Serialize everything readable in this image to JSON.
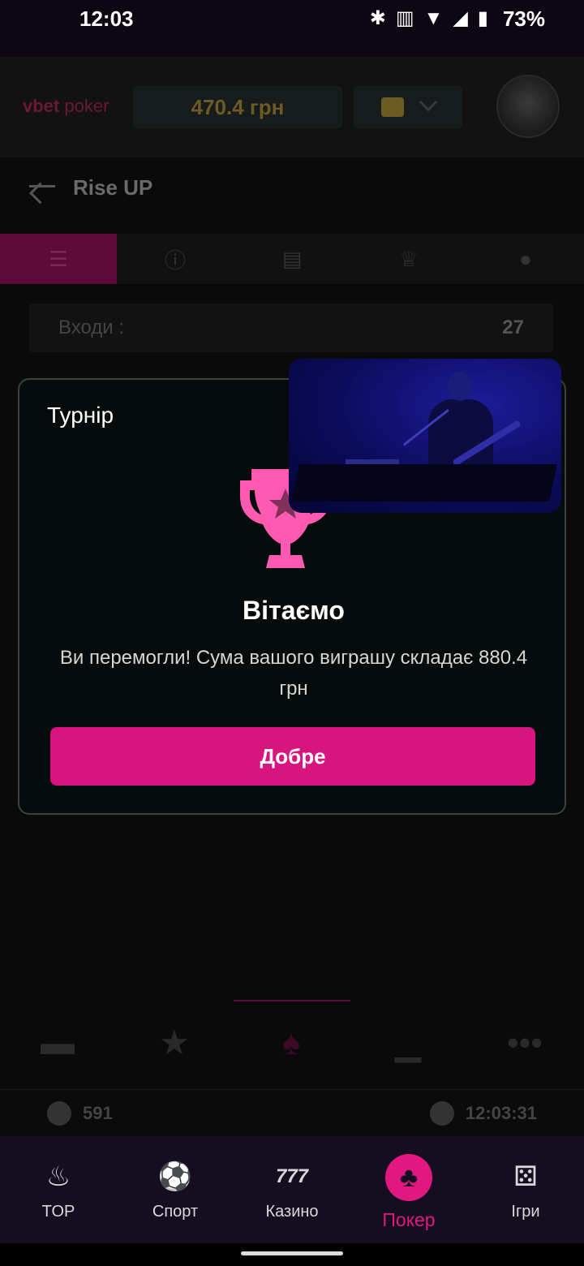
{
  "status_bar": {
    "time": "12:03",
    "battery": "73%"
  },
  "header": {
    "logo_brand": "vbet",
    "logo_product": "poker",
    "balance": "470.4 грн"
  },
  "page": {
    "title": "Rise UP"
  },
  "info": {
    "entries_label": "Входи :",
    "entries_value": "27"
  },
  "footer": {
    "players": "591",
    "clock": "12:03:31"
  },
  "dialog": {
    "title": "Турнір",
    "heading": "Вітаємо",
    "message": "Ви перемогли! Сума вашого виграшу складає 880.4 грн",
    "ok_label": "Добре"
  },
  "nav": {
    "items": [
      {
        "label": "TOP",
        "icon": "flame-icon"
      },
      {
        "label": "Спорт",
        "icon": "soccer-ball-icon"
      },
      {
        "label": "Казино",
        "icon": "slots-777-icon"
      },
      {
        "label": "Покер",
        "icon": "club-icon"
      },
      {
        "label": "Ігри",
        "icon": "dice-icon"
      }
    ],
    "active_index": 3
  },
  "colors": {
    "accent": "#d8147e",
    "trophy": "#ff5ab1",
    "nav_bg": "#150e20"
  }
}
